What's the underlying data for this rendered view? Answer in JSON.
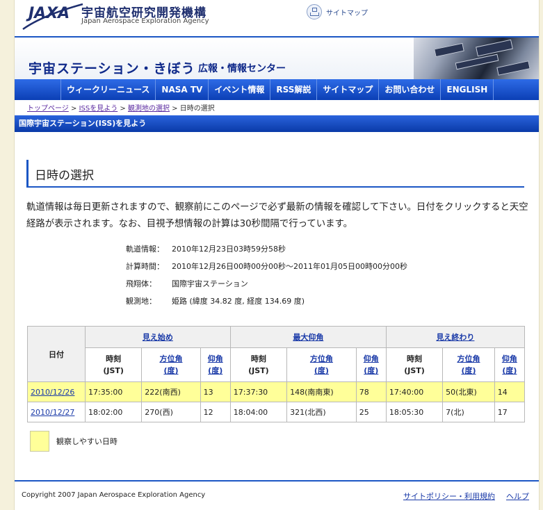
{
  "header": {
    "logo_text": "JAXA",
    "org_jp": "宇宙航空研究開発機構",
    "org_en": "Japan Aerospace Exploration Agency",
    "sitemap_label": "サイトマップ"
  },
  "banner": {
    "title": "宇宙ステーション・きぼう",
    "subtitle": "広報・情報センター"
  },
  "nav": [
    {
      "label": "ウィークリーニュース"
    },
    {
      "label": "NASA TV"
    },
    {
      "label": "イベント情報"
    },
    {
      "label": "RSS解説"
    },
    {
      "label": "サイトマップ"
    },
    {
      "label": "お問い合わせ"
    },
    {
      "label": "ENGLISH"
    }
  ],
  "breadcrumb": {
    "items": [
      "トップページ",
      "ISSを見よう",
      "観測地の選択"
    ],
    "current": "日時の選択",
    "sep": " > "
  },
  "section_title": "国際宇宙ステーション(ISS)を見よう",
  "page_heading": "日時の選択",
  "intro": "軌道情報は毎日更新されますので、観察前にこのページで必ず最新の情報を確認して下さい。日付をクリックすると天空経路が表示されます。なお、目視予想情報の計算は30秒間隔で行っています。",
  "info": [
    {
      "label": "軌道情報",
      "value": "2010年12月23日03時59分58秒"
    },
    {
      "label": "計算時間",
      "value": "2010年12月26日00時00分00秒〜2011年01月05日00時00分00秒"
    },
    {
      "label": "飛翔体",
      "value": "国際宇宙ステーション"
    },
    {
      "label": "観測地",
      "value": "姫路 (緯度 34.82 度, 経度 134.69 度)"
    }
  ],
  "info_sep": "：",
  "table": {
    "date_header": "日付",
    "groups": [
      "見え始め",
      "最大仰角",
      "見え終わり"
    ],
    "sub": {
      "time": [
        "時刻",
        "(JST)"
      ],
      "azimuth": [
        "方位角",
        "(度)"
      ],
      "elevation": [
        "仰角",
        "(度)"
      ]
    },
    "rows": [
      {
        "date": "2010/12/26",
        "good": true,
        "start": [
          "17:35:00",
          "222(南西)",
          "13"
        ],
        "max": [
          "17:37:30",
          "148(南南東)",
          "78"
        ],
        "end": [
          "17:40:00",
          "50(北東)",
          "14"
        ]
      },
      {
        "date": "2010/12/27",
        "good": false,
        "start": [
          "18:02:00",
          "270(西)",
          "12"
        ],
        "max": [
          "18:04:00",
          "321(北西)",
          "25"
        ],
        "end": [
          "18:05:30",
          "7(北)",
          "17"
        ]
      }
    ],
    "highlight_color": "#ffff99"
  },
  "legend_label": "観察しやすい日時",
  "footer": {
    "copyright": "Copyright 2007 Japan Aerospace Exploration Agency",
    "links": [
      "サイトポリシー・利用規約",
      "ヘルプ"
    ]
  }
}
